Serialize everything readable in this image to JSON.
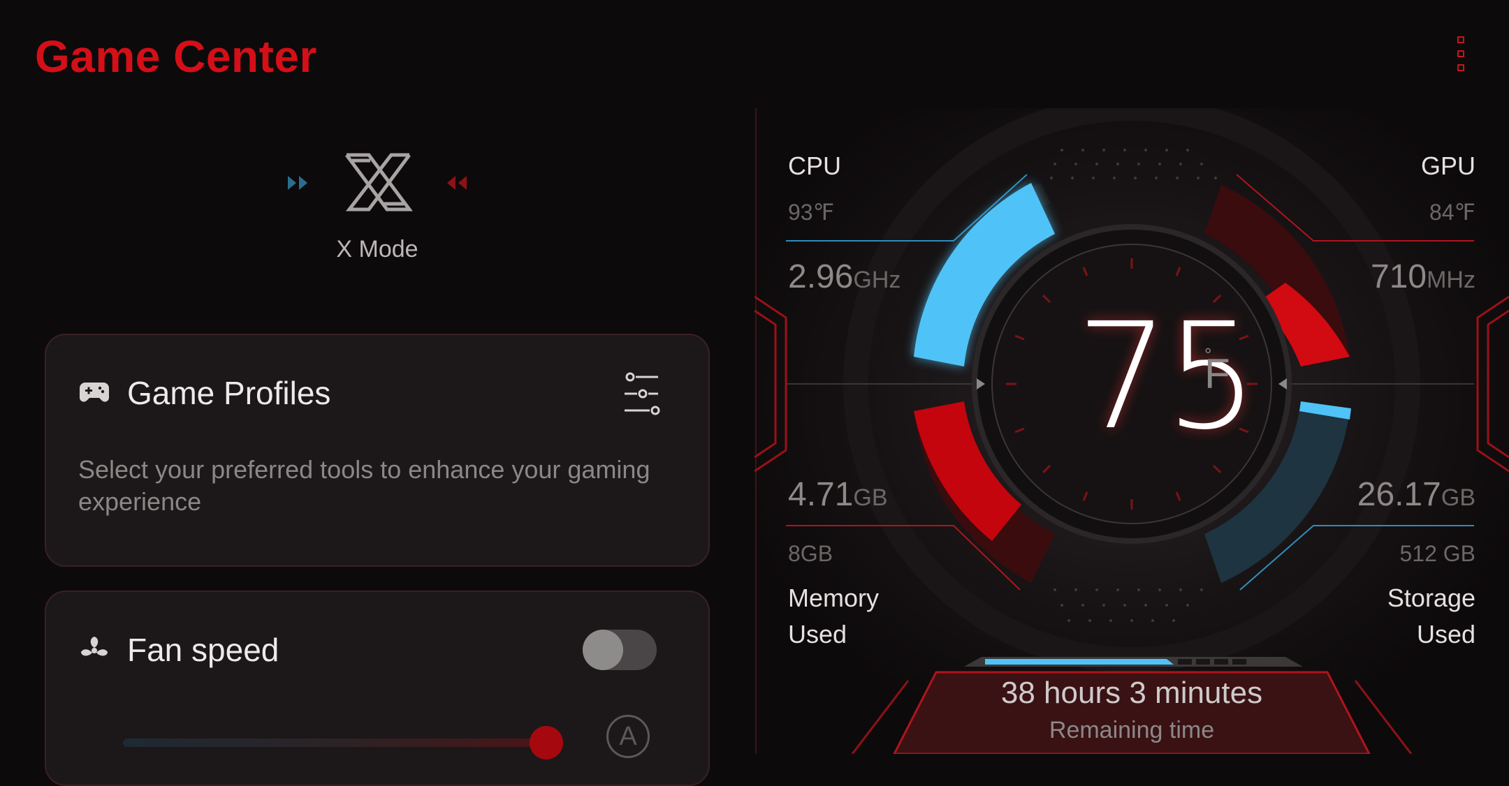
{
  "header": {
    "title": "Game Center"
  },
  "xmode": {
    "label": "X Mode"
  },
  "game_profiles": {
    "title": "Game Profiles",
    "description": "Select your preferred tools to enhance your gaming experience"
  },
  "fan": {
    "title": "Fan speed",
    "auto_label": "A",
    "enabled": false
  },
  "dashboard": {
    "temperature": {
      "value": "75",
      "unit": "F",
      "degree": "°"
    },
    "cpu": {
      "label": "CPU",
      "temp": "93℉",
      "freq": "2.96",
      "freq_unit": "GHz"
    },
    "gpu": {
      "label": "GPU",
      "temp": "84℉",
      "freq": "710",
      "freq_unit": "MHz"
    },
    "memory": {
      "used": "4.71",
      "unit": "GB",
      "total": "8GB",
      "label_line1": "Memory",
      "label_line2": "Used"
    },
    "storage": {
      "used": "26.17",
      "unit": "GB",
      "total": "512 GB",
      "label_line1": "Storage",
      "label_line2": "Used"
    },
    "battery": {
      "remaining": "38 hours 3 minutes",
      "caption": "Remaining time"
    }
  },
  "colors": {
    "accent_red": "#d40f18",
    "cyan": "#4fc3f7",
    "background": "#0d0a0b",
    "card": "#1c1819"
  }
}
